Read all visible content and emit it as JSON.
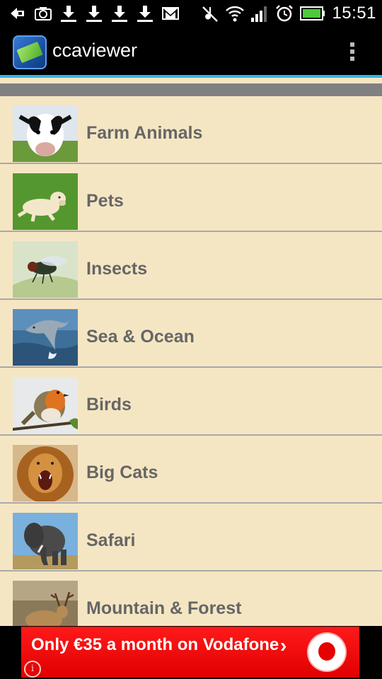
{
  "status_bar": {
    "time": "15:51",
    "left_icons": [
      "back-arrow-icon",
      "camera-icon",
      "download-icon",
      "download-icon",
      "download-icon",
      "download-icon",
      "gmail-icon"
    ],
    "right_icons": [
      "mute-icon",
      "wifi-icon",
      "signal-icon",
      "alarm-icon",
      "battery-icon"
    ]
  },
  "action_bar": {
    "title": "ccaviewer",
    "overflow_icon": "overflow-menu-icon"
  },
  "categories": [
    {
      "label": "Farm Animals",
      "thumb": "cow-photo"
    },
    {
      "label": "Pets",
      "thumb": "dog-photo"
    },
    {
      "label": "Insects",
      "thumb": "fly-photo"
    },
    {
      "label": "Sea & Ocean",
      "thumb": "dolphin-photo"
    },
    {
      "label": "Birds",
      "thumb": "robin-photo"
    },
    {
      "label": "Big Cats",
      "thumb": "lion-photo"
    },
    {
      "label": "Safari",
      "thumb": "elephant-photo"
    },
    {
      "label": "Mountain & Forest",
      "thumb": "deer-photo"
    }
  ],
  "ad": {
    "text": "Only €35 a month on Vodafone",
    "chevron": "›",
    "info": "i"
  },
  "colors": {
    "list_background": "#f5e6c3",
    "accent_line": "#33b5e5",
    "ad_red": "#e00000",
    "label_gray": "#666666"
  }
}
